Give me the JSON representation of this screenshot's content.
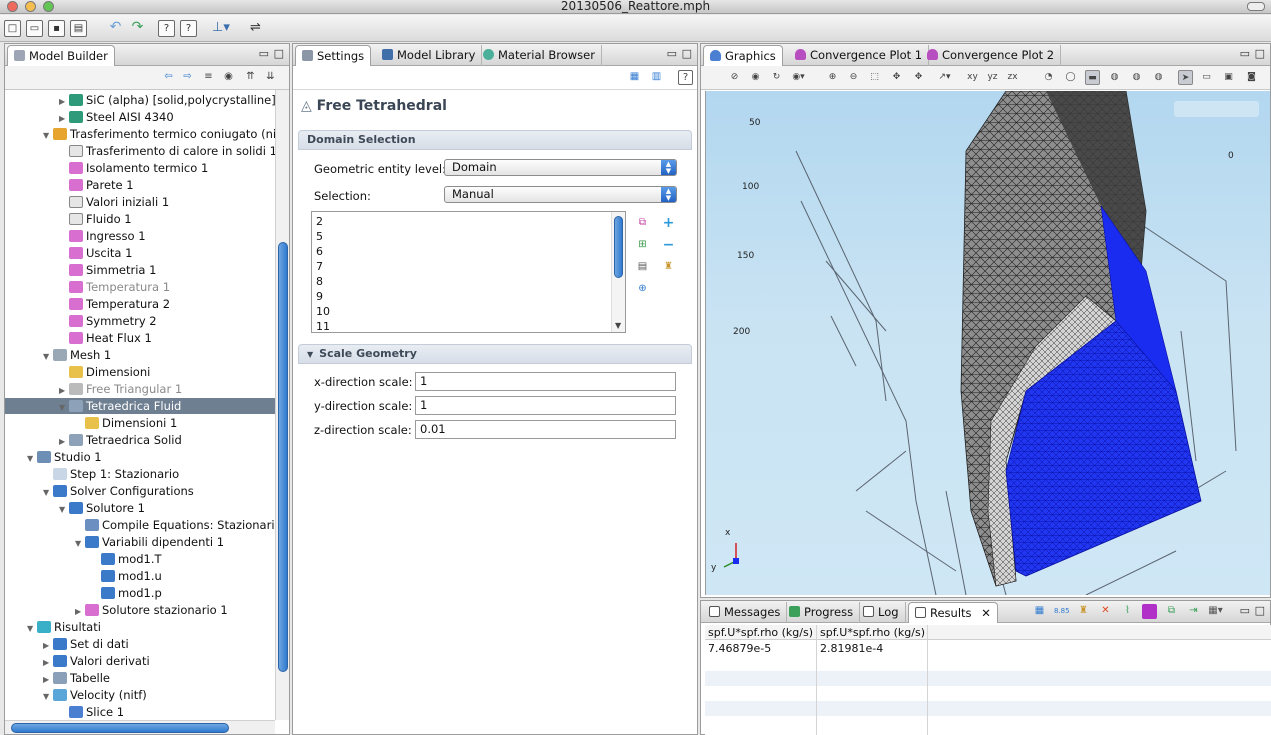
{
  "window": {
    "title": "20130506_Reattore.mph"
  },
  "toolbar": {
    "buttons": [
      "new-icon",
      "open-icon",
      "save-icon",
      "print-icon",
      "undo-icon",
      "redo-icon",
      "help-icon",
      "help-arrow-icon",
      "clear-icon",
      "split-icon"
    ]
  },
  "model_builder": {
    "tab_label": "Model Builder",
    "tree": [
      {
        "label": "SiC (alpha) [solid,polycrystalline]",
        "indent": 4,
        "expander": "closed",
        "icon": "material-icon",
        "grey": false
      },
      {
        "label": "Steel AISI 4340",
        "indent": 4,
        "expander": "closed",
        "icon": "material-icon",
        "grey": false
      },
      {
        "label": "Trasferimento termico coniugato (nit",
        "indent": 3,
        "expander": "open",
        "icon": "physics-icon",
        "grey": false,
        "italic_tail": true
      },
      {
        "label": "Trasferimento di calore in solidi 1",
        "indent": 4,
        "expander": "",
        "icon": "domain-icon",
        "grey": false
      },
      {
        "label": "Isolamento termico 1",
        "indent": 4,
        "expander": "",
        "icon": "boundary-icon",
        "grey": false
      },
      {
        "label": "Parete 1",
        "indent": 4,
        "expander": "",
        "icon": "boundary-icon",
        "grey": false
      },
      {
        "label": "Valori iniziali 1",
        "indent": 4,
        "expander": "",
        "icon": "domain-icon",
        "grey": false
      },
      {
        "label": "Fluido 1",
        "indent": 4,
        "expander": "",
        "icon": "domain-icon",
        "grey": false
      },
      {
        "label": "Ingresso 1",
        "indent": 4,
        "expander": "",
        "icon": "boundary-icon",
        "grey": false
      },
      {
        "label": "Uscita 1",
        "indent": 4,
        "expander": "",
        "icon": "boundary-icon",
        "grey": false
      },
      {
        "label": "Simmetria 1",
        "indent": 4,
        "expander": "",
        "icon": "boundary-icon",
        "grey": false
      },
      {
        "label": "Temperatura 1",
        "indent": 4,
        "expander": "",
        "icon": "boundary-icon",
        "grey": true
      },
      {
        "label": "Temperatura 2",
        "indent": 4,
        "expander": "",
        "icon": "boundary-icon",
        "grey": false
      },
      {
        "label": "Symmetry 2",
        "indent": 4,
        "expander": "",
        "icon": "boundary-icon",
        "grey": false
      },
      {
        "label": "Heat Flux 1",
        "indent": 4,
        "expander": "",
        "icon": "boundary-icon",
        "grey": false
      },
      {
        "label": "Mesh 1",
        "indent": 3,
        "expander": "open",
        "icon": "mesh-icon",
        "grey": false
      },
      {
        "label": "Dimensioni",
        "indent": 4,
        "expander": "",
        "icon": "size-icon",
        "grey": false
      },
      {
        "label": "Free Triangular 1",
        "indent": 4,
        "expander": "closed",
        "icon": "triangular-icon",
        "grey": true
      },
      {
        "label": "Tetraedrica Fluid",
        "indent": 4,
        "expander": "open",
        "icon": "tetra-icon",
        "grey": false,
        "selected": true
      },
      {
        "label": "Dimensioni 1",
        "indent": 5,
        "expander": "",
        "icon": "size-icon",
        "grey": false
      },
      {
        "label": "Tetraedrica Solid",
        "indent": 4,
        "expander": "closed",
        "icon": "tetra-icon",
        "grey": false
      },
      {
        "label": "Studio 1",
        "indent": 2,
        "expander": "open",
        "icon": "study-icon",
        "grey": false
      },
      {
        "label": "Step 1: Stazionario",
        "indent": 3,
        "expander": "",
        "icon": "step-icon",
        "grey": false
      },
      {
        "label": "Solver Configurations",
        "indent": 3,
        "expander": "open",
        "icon": "solver-icon",
        "grey": false
      },
      {
        "label": "Solutore 1",
        "indent": 4,
        "expander": "open",
        "icon": "solver-icon",
        "grey": false
      },
      {
        "label": "Compile Equations: Stazionario",
        "indent": 5,
        "expander": "",
        "icon": "equations-icon",
        "grey": false
      },
      {
        "label": "Variabili dipendenti 1",
        "indent": 5,
        "expander": "open",
        "icon": "variables-icon",
        "grey": false
      },
      {
        "label": "mod1.T",
        "indent": 6,
        "expander": "",
        "icon": "variable-icon",
        "grey": false
      },
      {
        "label": "mod1.u",
        "indent": 6,
        "expander": "",
        "icon": "variable-icon",
        "grey": false
      },
      {
        "label": "mod1.p",
        "indent": 6,
        "expander": "",
        "icon": "variable-icon",
        "grey": false
      },
      {
        "label": "Solutore stazionario 1",
        "indent": 5,
        "expander": "closed",
        "icon": "stationary-icon",
        "grey": false
      },
      {
        "label": "Risultati",
        "indent": 2,
        "expander": "open",
        "icon": "results-icon",
        "grey": false
      },
      {
        "label": "Set di dati",
        "indent": 3,
        "expander": "closed",
        "icon": "dataset-icon",
        "grey": false
      },
      {
        "label": "Valori derivati",
        "indent": 3,
        "expander": "closed",
        "icon": "derived-icon",
        "grey": false
      },
      {
        "label": "Tabelle",
        "indent": 3,
        "expander": "closed",
        "icon": "table-icon",
        "grey": false
      },
      {
        "label": "Velocity (nitf)",
        "indent": 3,
        "expander": "open",
        "icon": "plot-icon",
        "grey": false
      },
      {
        "label": "Slice 1",
        "indent": 4,
        "expander": "",
        "icon": "slice-icon",
        "grey": false
      }
    ]
  },
  "settings": {
    "tabs": [
      "Settings",
      "Model Library",
      "Material Browser"
    ],
    "title": "Free Tetrahedral",
    "domain_selection": {
      "header": "Domain Selection",
      "entity_level_label": "Geometric entity level:",
      "entity_level_value": "Domain",
      "selection_label": "Selection:",
      "selection_value": "Manual",
      "items": [
        "2",
        "5",
        "6",
        "7",
        "8",
        "9",
        "10",
        "11"
      ]
    },
    "scale_geometry": {
      "header": "Scale Geometry",
      "x_label": "x-direction scale:",
      "x_value": "1",
      "y_label": "y-direction scale:",
      "y_value": "1",
      "z_label": "z-direction scale:",
      "z_value": "0.01"
    }
  },
  "graphics": {
    "tabs": [
      "Graphics",
      "Convergence Plot 1",
      "Convergence Plot 2"
    ],
    "axis_labels": [
      "50",
      "100",
      "150",
      "200",
      "0"
    ],
    "triad": {
      "x": "x",
      "y": "y"
    }
  },
  "results_panel": {
    "tabs": [
      "Messages",
      "Progress",
      "Log",
      "Results"
    ],
    "columns": [
      "spf.U*spf.rho (kg/s)",
      "spf.U*spf.rho (kg/s)"
    ],
    "rows": [
      [
        "7.46879e-5",
        "2.81981e-4"
      ]
    ]
  },
  "colors": {
    "accent": "#2f7ad0",
    "selection_bg": "#6f7f92",
    "mesh_blue": "#1a2cf0",
    "mesh_grey": "#8a8a8a"
  }
}
